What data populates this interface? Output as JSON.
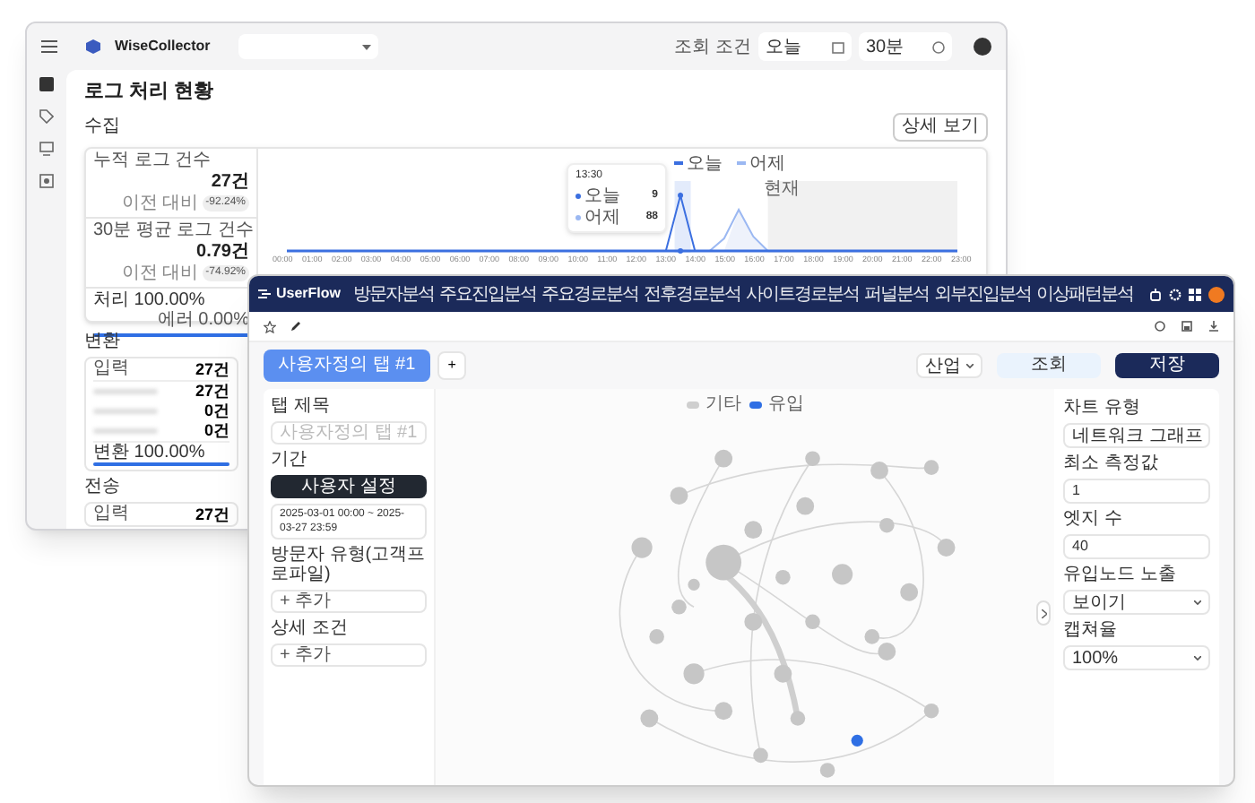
{
  "collector": {
    "app_name": "WiseCollector",
    "filter_label": "조회 조건",
    "date_value": "오늘",
    "interval_value": "30분",
    "page_title": "로그 처리 현황",
    "collect": {
      "title": "수집",
      "detail_button": "상세 보기",
      "stats": [
        {
          "label": "누적 로그 건수",
          "value": "27건",
          "compare_label": "이전 대비",
          "change": "-92.24%"
        },
        {
          "label": "30분 평균 로그 건수",
          "value": "0.79건",
          "compare_label": "이전 대비",
          "change": "-74.92%"
        }
      ],
      "process": {
        "label": "처리 100.00%",
        "error": "에러 0.00%",
        "level": 1
      },
      "legend": [
        {
          "label": "오늘",
          "color": "#3b6fe0"
        },
        {
          "label": "어제",
          "color": "#9bb8f2"
        }
      ],
      "x_ticks": [
        "00:00",
        "01:00",
        "02:00",
        "03:00",
        "04:00",
        "05:00",
        "06:00",
        "07:00",
        "08:00",
        "09:00",
        "10:00",
        "11:00",
        "12:00",
        "13:00",
        "14:00",
        "15:00",
        "16:00",
        "17:00",
        "18:00",
        "19:00",
        "20:00",
        "21:00",
        "22:00",
        "23:00"
      ],
      "now_label": "현재",
      "tooltip": {
        "time": "13:30",
        "rows": [
          {
            "label": "오늘",
            "value": "9",
            "color": "#3b6fe0"
          },
          {
            "label": "어제",
            "value": "88",
            "color": "#9bb8f2"
          }
        ]
      }
    },
    "convert": {
      "title": "변환",
      "input_label": "입력",
      "input_value": "27건",
      "rows": [
        {
          "value": "27건"
        },
        {
          "value": "0건"
        },
        {
          "value": "0건"
        }
      ],
      "result": {
        "label": "변환 100.00%",
        "level": 1
      }
    },
    "send": {
      "title": "전송",
      "input_label": "입력",
      "input_value": "27건"
    }
  },
  "userflow": {
    "app_name": "UserFlow",
    "nav": [
      "방문자분석",
      "주요진입분석",
      "주요경로분석",
      "전후경로분석",
      "사이트경로분석",
      "퍼널분석",
      "외부진입분석",
      "이상패턴분석"
    ],
    "tabs": [
      {
        "label": "사용자정의 탭 #1",
        "selected": true
      }
    ],
    "add_tab": "+",
    "sort_dropdown": "산업",
    "search_button": "조회",
    "save_button": "저장",
    "left_panel": {
      "tab_title_label": "탭 제목",
      "tab_title_placeholder": "사용자정의 탭 #1",
      "period_label": "기간",
      "period_button": "사용자 설정",
      "period_value": "2025-03-01 00:00 ~ 2025-03-27 23:59",
      "visitor_type_label": "방문자 유형(고객프로파일)",
      "visitor_type_add": "+ 추가",
      "detail_label": "상세 조건",
      "detail_add": "+ 추가"
    },
    "legend": [
      {
        "label": "기타",
        "color": "#cfcfcf"
      },
      {
        "label": "유입",
        "color": "#2f6fe4"
      }
    ],
    "settings": [
      {
        "label": "차트 유형",
        "kind": "select",
        "value": "네트워크 그래프"
      },
      {
        "label": "최소 측정값",
        "kind": "input",
        "value": "1"
      },
      {
        "label": "엣지 수",
        "kind": "input",
        "value": "40"
      },
      {
        "label": "유입노드 노출",
        "kind": "select",
        "value": "보이기"
      },
      {
        "label": "캡쳐율",
        "kind": "select",
        "value": "100%"
      }
    ]
  }
}
